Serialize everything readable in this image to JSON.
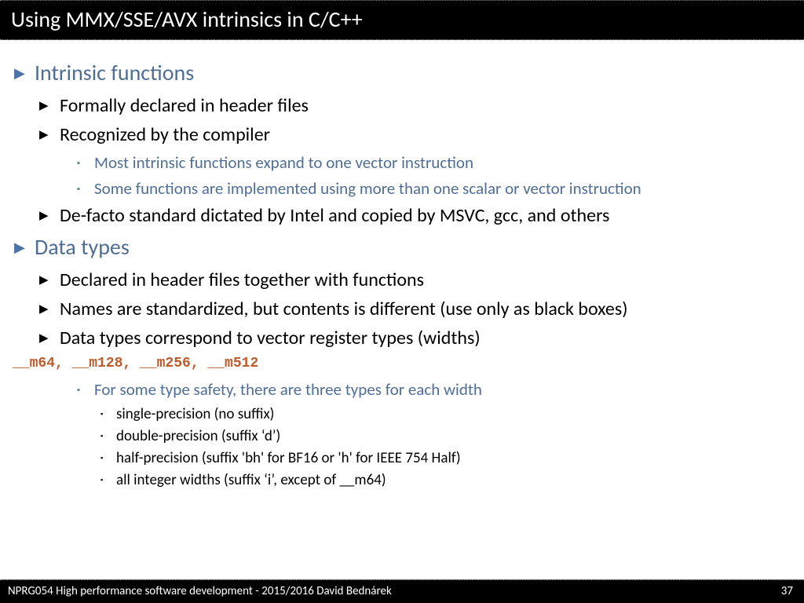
{
  "title": "Using MMX/SSE/AVX intrinsics in C/C++",
  "s1": {
    "heading": "Intrinsic functions",
    "b1": "Formally declared in header files",
    "b2": "Recognized by the compiler",
    "b2s1": "Most intrinsic functions expand to one vector instruction",
    "b2s2": "Some functions are implemented using more than one scalar or vector instruction",
    "b3": "De-facto standard dictated by Intel and copied by MSVC, gcc, and others"
  },
  "s2": {
    "heading": "Data types",
    "b1": "Declared in header files together with functions",
    "b2": "Names are standardized, but contents is different (use only as black boxes)",
    "b3": "Data types correspond to vector register types (widths)",
    "code": "__m64, __m128, __m256, __m512",
    "sub1": "For some type safety, there are three types for each width",
    "sub1a": "single-precision (no suffix)",
    "sub1b": "double-precision (suffix ‘d’)",
    "sub1c": "half-precision (suffix 'bh' for BF16 or 'h' for IEEE 754 Half)",
    "sub1d": "all integer widths (suffix ‘i’, except of __m64)"
  },
  "footer": {
    "left": "NPRG054 High performance  software development - 2015/2016 David Bednárek",
    "page": "37"
  }
}
